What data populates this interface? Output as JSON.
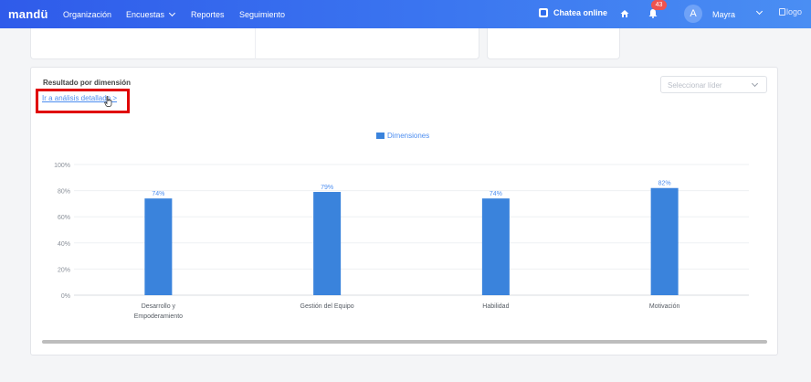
{
  "navbar": {
    "brand": "mandü",
    "items": [
      "Organización",
      "Encuestas",
      "Reportes",
      "Seguimiento"
    ],
    "chat_label": "Chatea online",
    "notifications_count": "43",
    "avatar_letter": "A",
    "user_name": "Mayra",
    "logo_alt": "logo",
    "colors": {
      "bar_start": "#2f5bea",
      "bar_end": "#4a8ef3"
    }
  },
  "panel": {
    "title": "Resultado por dimensión",
    "detail_link": "Ir a análisis detallado >",
    "leader_placeholder": "Seleccionar líder"
  },
  "chart_data": {
    "type": "bar",
    "categories": [
      "Desarrollo y Empoderamiento",
      "Gestión del Equipo",
      "Habilidad",
      "Motivación"
    ],
    "category_lines": [
      [
        "Desarrollo y",
        "Empoderamiento"
      ],
      [
        "Gestión del Equipo"
      ],
      [
        "Habilidad"
      ],
      [
        "Motivación"
      ]
    ],
    "series": [
      {
        "name": "Dimensiones",
        "values": [
          74,
          79,
          74,
          82
        ]
      }
    ],
    "data_labels": [
      "74%",
      "79%",
      "74%",
      "82%"
    ],
    "y_ticks": [
      "0%",
      "20%",
      "40%",
      "60%",
      "80%",
      "100%"
    ],
    "ylim": [
      0,
      100
    ],
    "grid": true,
    "legend": "top-center",
    "bar_color": "#3a83dc"
  }
}
